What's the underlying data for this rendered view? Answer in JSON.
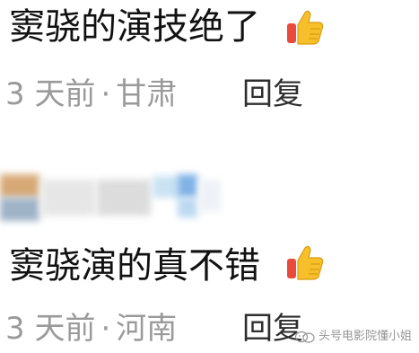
{
  "comments": [
    {
      "text": "窦骁的演技绝了",
      "emoji": "thumbs-up-icon",
      "time": "3 天前",
      "separator": "·",
      "location": "甘肃",
      "reply_label": "回复"
    },
    {
      "text": "窦骁演的真不错",
      "emoji": "thumbs-up-icon",
      "time": "3 天前",
      "separator": "·",
      "location": "河南",
      "reply_label": "回复"
    }
  ],
  "watermark": {
    "text": "头号电影院懂小姐",
    "icon": "wechat-official-account-icon"
  },
  "colors": {
    "text": "#111111",
    "meta": "#9a9a9a",
    "reply": "#2e2e2e",
    "thumb_yellow": "#f7c02b",
    "thumb_red": "#e84b3c"
  }
}
